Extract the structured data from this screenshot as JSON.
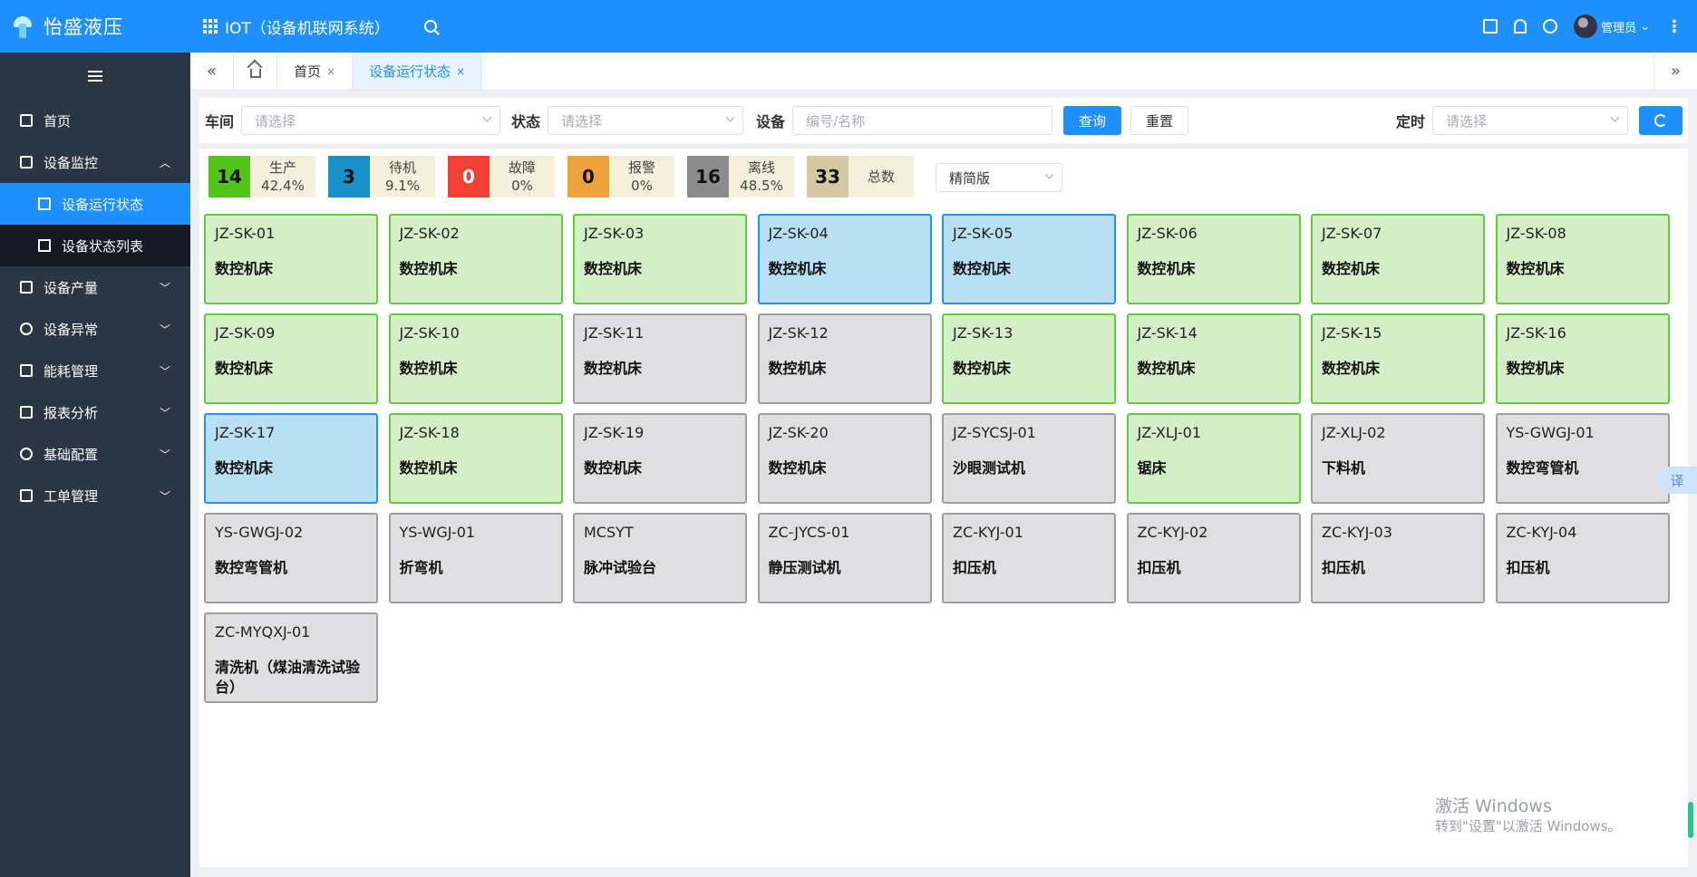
{
  "topbar": {
    "brand": "怡盛液压",
    "system_title": "IOT（设备机联网系统）",
    "username": "管理员"
  },
  "sidebar": {
    "items": [
      {
        "label": "首页",
        "icon": "home-icon",
        "expanded": false
      },
      {
        "label": "设备监控",
        "icon": "monitor-icon",
        "expanded": true,
        "chevron": "^"
      },
      {
        "label": "设备产量",
        "icon": "chart-icon",
        "chevron": "v"
      },
      {
        "label": "设备异常",
        "icon": "alert-icon",
        "chevron": "v"
      },
      {
        "label": "能耗管理",
        "icon": "energy-icon",
        "chevron": "v"
      },
      {
        "label": "报表分析",
        "icon": "report-icon",
        "chevron": "v"
      },
      {
        "label": "基础配置",
        "icon": "gear-icon",
        "chevron": "v"
      },
      {
        "label": "工单管理",
        "icon": "layers-icon",
        "chevron": "v"
      }
    ],
    "sub_items": [
      {
        "label": "设备运行状态",
        "active": true
      },
      {
        "label": "设备状态列表",
        "active": false
      }
    ]
  },
  "tabs": [
    {
      "label": "首页",
      "active": false
    },
    {
      "label": "设备运行状态",
      "active": true
    }
  ],
  "filters": {
    "workshop_label": "车间",
    "workshop_placeholder": "请选择",
    "status_label": "状态",
    "status_placeholder": "请选择",
    "device_label": "设备",
    "device_placeholder": "编号/名称",
    "query_button": "查询",
    "reset_button": "重置",
    "timer_label": "定时",
    "timer_placeholder": "请选择"
  },
  "stats": [
    {
      "count": "14",
      "label": "生产",
      "percent": "42.4%",
      "color": "#52c41a",
      "text_color": "#111",
      "bg": "#f5f0dc"
    },
    {
      "count": "3",
      "label": "待机",
      "percent": "9.1%",
      "color": "#1890c8",
      "text_color": "#111",
      "bg": "#f5f0dc"
    },
    {
      "count": "0",
      "label": "故障",
      "percent": "0%",
      "color": "#f04134",
      "text_color": "#fff",
      "bg": "#f5f0dc"
    },
    {
      "count": "0",
      "label": "报警",
      "percent": "0%",
      "color": "#eea23a",
      "text_color": "#111",
      "bg": "#f5f0dc"
    },
    {
      "count": "16",
      "label": "离线",
      "percent": "48.5%",
      "color": "#8c8c8c",
      "text_color": "#111",
      "bg": "#f5f0dc"
    },
    {
      "count": "33",
      "label": "总数",
      "percent": "",
      "color": "#d4c9a0",
      "text_color": "#111",
      "bg": "#f5f0dc"
    }
  ],
  "view_mode": "精简版",
  "devices": [
    {
      "code": "JZ-SK-01",
      "type": "数控机床",
      "status": "production"
    },
    {
      "code": "JZ-SK-02",
      "type": "数控机床",
      "status": "production"
    },
    {
      "code": "JZ-SK-03",
      "type": "数控机床",
      "status": "production"
    },
    {
      "code": "JZ-SK-04",
      "type": "数控机床",
      "status": "standby"
    },
    {
      "code": "JZ-SK-05",
      "type": "数控机床",
      "status": "standby"
    },
    {
      "code": "JZ-SK-06",
      "type": "数控机床",
      "status": "production"
    },
    {
      "code": "JZ-SK-07",
      "type": "数控机床",
      "status": "production"
    },
    {
      "code": "JZ-SK-08",
      "type": "数控机床",
      "status": "production"
    },
    {
      "code": "JZ-SK-09",
      "type": "数控机床",
      "status": "production"
    },
    {
      "code": "JZ-SK-10",
      "type": "数控机床",
      "status": "production"
    },
    {
      "code": "JZ-SK-11",
      "type": "数控机床",
      "status": "offline"
    },
    {
      "code": "JZ-SK-12",
      "type": "数控机床",
      "status": "offline"
    },
    {
      "code": "JZ-SK-13",
      "type": "数控机床",
      "status": "production"
    },
    {
      "code": "JZ-SK-14",
      "type": "数控机床",
      "status": "production"
    },
    {
      "code": "JZ-SK-15",
      "type": "数控机床",
      "status": "production"
    },
    {
      "code": "JZ-SK-16",
      "type": "数控机床",
      "status": "production"
    },
    {
      "code": "JZ-SK-17",
      "type": "数控机床",
      "status": "standby"
    },
    {
      "code": "JZ-SK-18",
      "type": "数控机床",
      "status": "production"
    },
    {
      "code": "JZ-SK-19",
      "type": "数控机床",
      "status": "offline"
    },
    {
      "code": "JZ-SK-20",
      "type": "数控机床",
      "status": "offline"
    },
    {
      "code": "JZ-SYCSJ-01",
      "type": "沙眼测试机",
      "status": "offline"
    },
    {
      "code": "JZ-XLJ-01",
      "type": "锯床",
      "status": "production"
    },
    {
      "code": "JZ-XLJ-02",
      "type": "下料机",
      "status": "offline"
    },
    {
      "code": "YS-GWGJ-01",
      "type": "数控弯管机",
      "status": "offline"
    },
    {
      "code": "YS-GWGJ-02",
      "type": "数控弯管机",
      "status": "offline"
    },
    {
      "code": "YS-WGJ-01",
      "type": "折弯机",
      "status": "offline"
    },
    {
      "code": "MCSYT",
      "type": "脉冲试验台",
      "status": "offline"
    },
    {
      "code": "ZC-JYCS-01",
      "type": "静压测试机",
      "status": "offline"
    },
    {
      "code": "ZC-KYJ-01",
      "type": "扣压机",
      "status": "offline"
    },
    {
      "code": "ZC-KYJ-02",
      "type": "扣压机",
      "status": "offline"
    },
    {
      "code": "ZC-KYJ-03",
      "type": "扣压机",
      "status": "offline"
    },
    {
      "code": "ZC-KYJ-04",
      "type": "扣压机",
      "status": "offline"
    },
    {
      "code": "ZC-MYQXJ-01",
      "type": "清洗机（煤油清洗试验台）",
      "status": "offline"
    }
  ],
  "overlay": {
    "translate": "译",
    "watermark_line1": "激活 Windows",
    "watermark_line2": "转到\"设置\"以激活 Windows。"
  }
}
